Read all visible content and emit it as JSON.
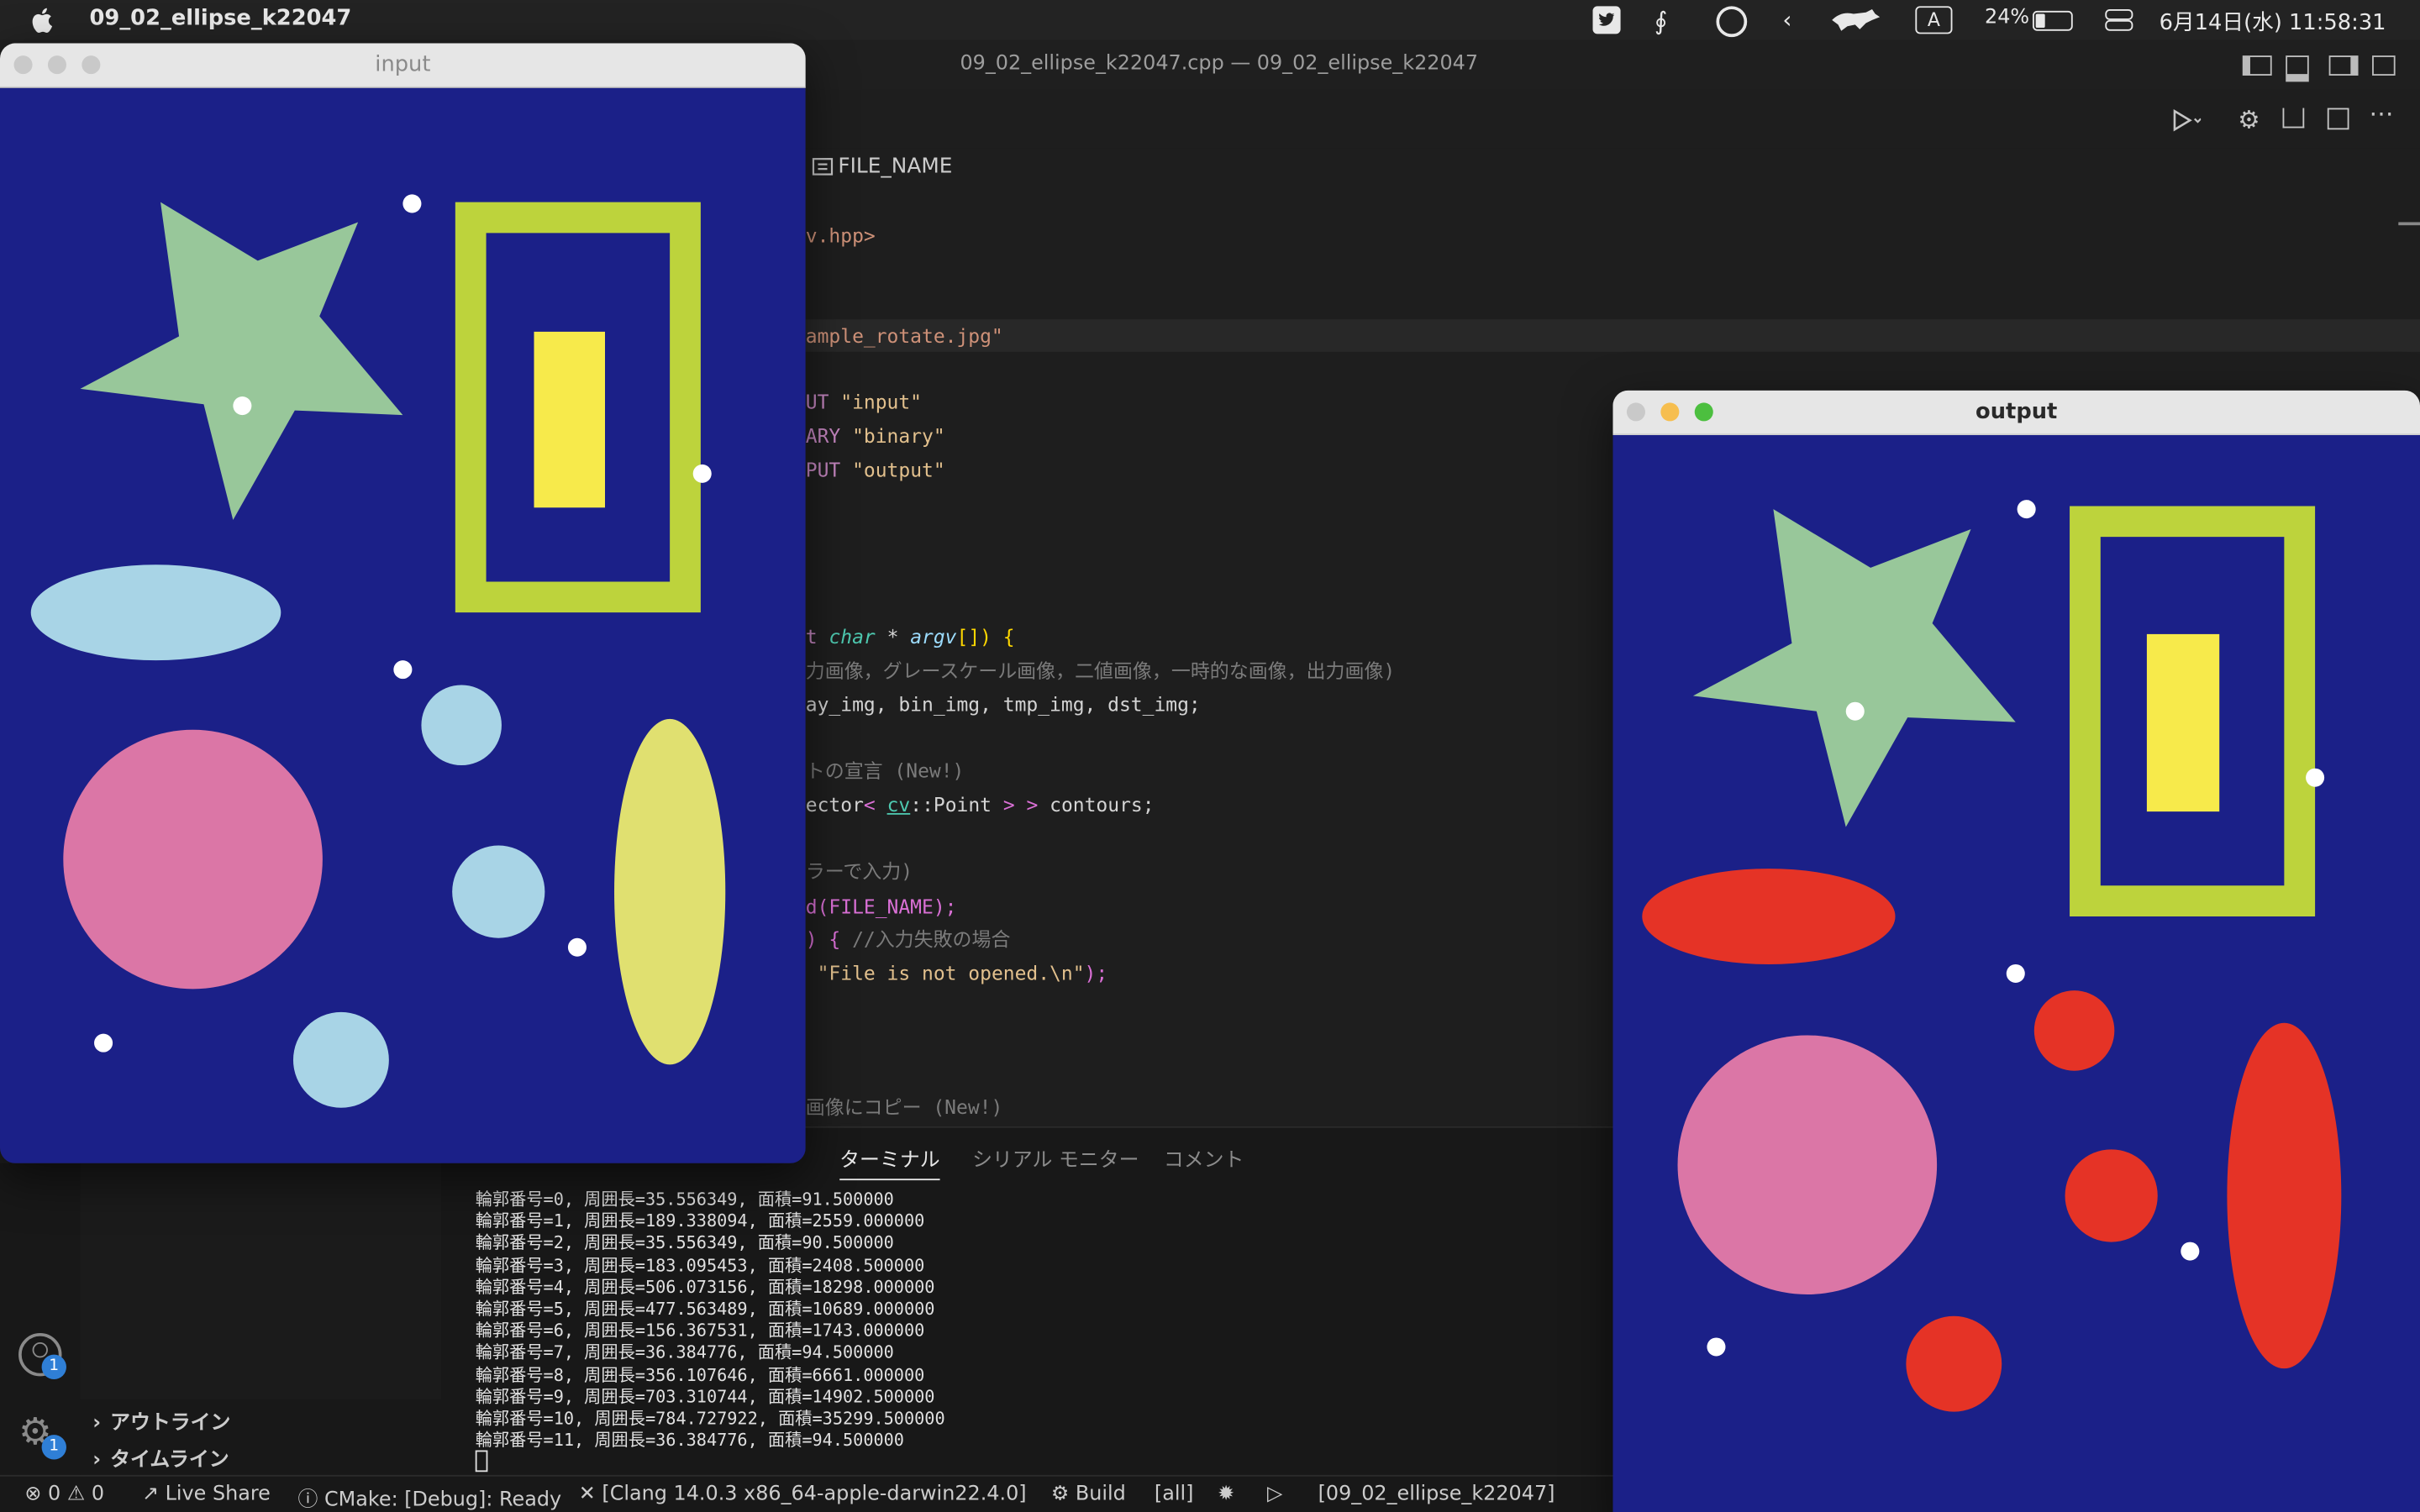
{
  "menubar": {
    "app_name": "09_02_ellipse_k22047",
    "battery": "24%",
    "datetime": "6月14日(水) 11:58:31",
    "input_source": "A"
  },
  "vscode": {
    "window_title": "09_02_ellipse_k22047.cpp — 09_02_ellipse_k22047",
    "breadcrumb": "FILE_NAME",
    "code_lines": {
      "l1": "v.hpp>",
      "l2_a": "ample_rotate.jpg\"",
      "l3_a": "UT ",
      "l3_b": "\"input\"",
      "l4_a": "ARY ",
      "l4_b": "\"binary\"",
      "l5_a": "PUT ",
      "l5_b": "\"output\"",
      "l6_a": "t ",
      "l6_b": "char",
      "l6_c": " * ",
      "l6_d": "argv",
      "l6_e": "[]) {",
      "l7": "力画像，グレースケール画像，二値画像，一時的な画像，出力画像)",
      "l8": "ay_img, bin_img, tmp_img, dst_img;",
      "l9": "トの宣言 (New!)",
      "l10_a": "ector",
      "l10_b": "< ",
      "l10_c": "cv",
      "l10_d": "::Point ",
      "l10_e": "> >",
      "l10_f": " contours;",
      "l11": "ラーで入力)",
      "l12_a": "d(FILE_NAME);",
      "l13_a": ") { ",
      "l13_b": "//入力失敗の場合",
      "l14_a": " ",
      "l14_b": "\"File is not opened.\\n\"",
      "l14_c": ");",
      "l15": "画像にコピー (New!)"
    },
    "panel_tabs": [
      "ターミナル",
      "シリアル モニター",
      "コメント"
    ],
    "terminal_lines": [
      "輪郭番号=0, 周囲長=35.556349, 面積=91.500000",
      "輪郭番号=1, 周囲長=189.338094, 面積=2559.000000",
      "輪郭番号=2, 周囲長=35.556349, 面積=90.500000",
      "輪郭番号=3, 周囲長=183.095453, 面積=2408.500000",
      "輪郭番号=4, 周囲長=506.073156, 面積=18298.000000",
      "輪郭番号=5, 周囲長=477.563489, 面積=10689.000000",
      "輪郭番号=6, 周囲長=156.367531, 面積=1743.000000",
      "輪郭番号=7, 周囲長=36.384776, 面積=94.500000",
      "輪郭番号=8, 周囲長=356.107646, 面積=6661.000000",
      "輪郭番号=9, 周囲長=703.310744, 面積=14902.500000",
      "輪郭番号=10, 周囲長=784.727922, 面積=35299.500000",
      "輪郭番号=11, 周囲長=36.384776, 面積=94.500000"
    ],
    "sidebar": {
      "outline": "アウトライン",
      "timeline": "タイムライン"
    },
    "badges": {
      "accounts": "1",
      "manage": "1"
    },
    "statusbar": {
      "errors": "0",
      "warnings": "0",
      "live_share": "Live Share",
      "cmake": "CMake: [Debug]: Ready",
      "kit": "[Clang 14.0.3 x86_64-apple-darwin22.4.0]",
      "build": "Build",
      "target": "[all]",
      "launch_target": "[09_02_ellipse_k22047]"
    }
  },
  "input_window": {
    "title": "input",
    "colors": {
      "background": "#1b2088",
      "star": "#98c79a",
      "frame": "#bdd33c",
      "inner_rect": "#f7ea4b",
      "ellipse": "#a8d4e6",
      "circle_pink": "#db76a6",
      "circle_blue": "#a8d4e6",
      "ellipse_yellow": "#e0e070",
      "dots": "#ffffff"
    }
  },
  "output_window": {
    "title": "output",
    "colors": {
      "background": "#1b2088",
      "star": "#98c79a",
      "frame": "#bdd33c",
      "inner_rect": "#f7ea4b",
      "ellipse": "#e53326",
      "circle_pink": "#db76a6",
      "circle_red": "#e53326",
      "dots": "#ffffff"
    }
  }
}
